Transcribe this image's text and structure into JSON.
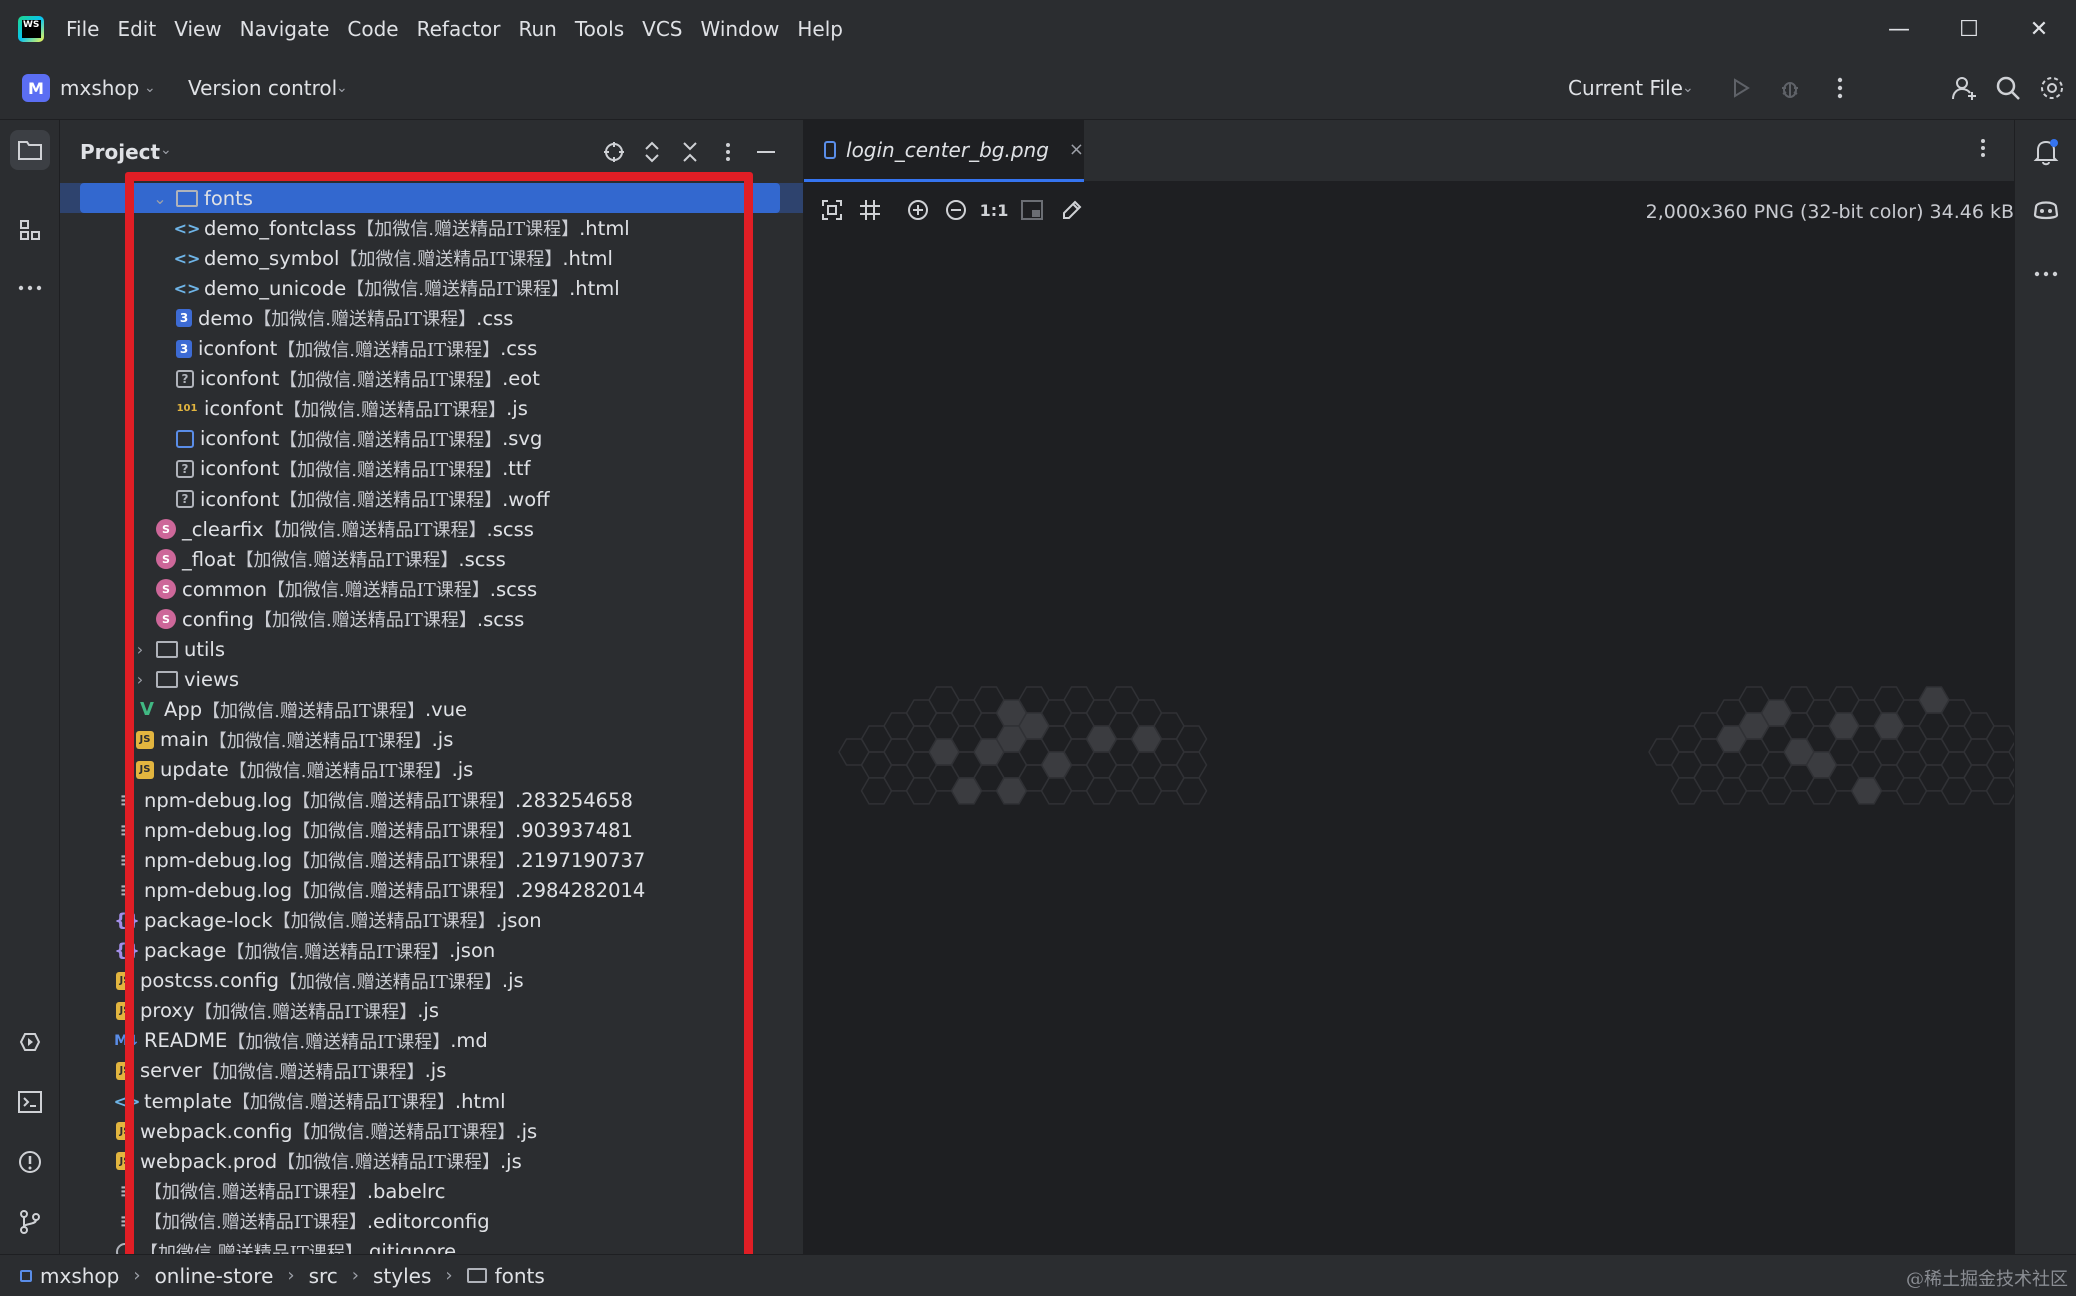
{
  "menu": [
    "File",
    "Edit",
    "View",
    "Navigate",
    "Code",
    "Refactor",
    "Run",
    "Tools",
    "VCS",
    "Window",
    "Help"
  ],
  "window_controls": {
    "minimize": "—",
    "maximize": "☐",
    "close": "✕"
  },
  "toolbar": {
    "project_badge": "M",
    "project_name": "mxshop",
    "version_control": "Version control",
    "run_config": "Current File"
  },
  "project_panel": {
    "title": "Project",
    "rows": [
      {
        "indent": 2,
        "icon": "folder",
        "expanded": true,
        "name": "fonts",
        "tag": "",
        "ext": "",
        "selected": true
      },
      {
        "indent": 3,
        "icon": "html",
        "name": "demo_fontclass",
        "tag": "【加微信.赠送精品IT课程】",
        "ext": ".html"
      },
      {
        "indent": 3,
        "icon": "html",
        "name": "demo_symbol",
        "tag": "【加微信.赠送精品IT课程】",
        "ext": ".html"
      },
      {
        "indent": 3,
        "icon": "html",
        "name": "demo_unicode",
        "tag": "【加微信.赠送精品IT课程】",
        "ext": ".html"
      },
      {
        "indent": 3,
        "icon": "css",
        "name": "demo",
        "tag": "【加微信.赠送精品IT课程】",
        "ext": ".css"
      },
      {
        "indent": 3,
        "icon": "css",
        "name": "iconfont",
        "tag": "【加微信.赠送精品IT课程】",
        "ext": ".css"
      },
      {
        "indent": 3,
        "icon": "unknown",
        "name": "iconfont",
        "tag": "【加微信.赠送精品IT课程】",
        "ext": ".eot"
      },
      {
        "indent": 3,
        "icon": "jsmap",
        "name": "iconfont",
        "tag": "【加微信.赠送精品IT课程】",
        "ext": ".js"
      },
      {
        "indent": 3,
        "icon": "svg",
        "name": "iconfont",
        "tag": "【加微信.赠送精品IT课程】",
        "ext": ".svg"
      },
      {
        "indent": 3,
        "icon": "unknown",
        "name": "iconfont",
        "tag": "【加微信.赠送精品IT课程】",
        "ext": ".ttf"
      },
      {
        "indent": 3,
        "icon": "unknown",
        "name": "iconfont",
        "tag": "【加微信.赠送精品IT课程】",
        "ext": ".woff"
      },
      {
        "indent": 2,
        "icon": "scss",
        "name": "_clearfix",
        "tag": "【加微信.赠送精品IT课程】",
        "ext": ".scss"
      },
      {
        "indent": 2,
        "icon": "scss",
        "name": "_float",
        "tag": "【加微信.赠送精品IT课程】",
        "ext": ".scss"
      },
      {
        "indent": 2,
        "icon": "scss",
        "name": "common",
        "tag": "【加微信.赠送精品IT课程】",
        "ext": ".scss"
      },
      {
        "indent": 2,
        "icon": "scss",
        "name": "confing",
        "tag": "【加微信.赠送精品IT课程】",
        "ext": ".scss"
      },
      {
        "indent": 1,
        "icon": "folder",
        "expanded": false,
        "name": "utils",
        "tag": "",
        "ext": ""
      },
      {
        "indent": 1,
        "icon": "folder",
        "expanded": false,
        "name": "views",
        "tag": "",
        "ext": ""
      },
      {
        "indent": 1,
        "icon": "vue",
        "name": "App",
        "tag": "【加微信.赠送精品IT课程】",
        "ext": ".vue"
      },
      {
        "indent": 1,
        "icon": "js",
        "name": "main",
        "tag": "【加微信.赠送精品IT课程】",
        "ext": ".js"
      },
      {
        "indent": 1,
        "icon": "js",
        "name": "update",
        "tag": "【加微信.赠送精品IT课程】",
        "ext": ".js"
      },
      {
        "indent": 0,
        "icon": "text",
        "name": "npm-debug.log",
        "tag": "【加微信.赠送精品IT课程】",
        "ext": ".283254658"
      },
      {
        "indent": 0,
        "icon": "text",
        "name": "npm-debug.log",
        "tag": "【加微信.赠送精品IT课程】",
        "ext": ".903937481"
      },
      {
        "indent": 0,
        "icon": "text",
        "name": "npm-debug.log",
        "tag": "【加微信.赠送精品IT课程】",
        "ext": ".2197190737"
      },
      {
        "indent": 0,
        "icon": "text",
        "name": "npm-debug.log",
        "tag": "【加微信.赠送精品IT课程】",
        "ext": ".2984282014"
      },
      {
        "indent": 0,
        "icon": "json",
        "name": "package-lock",
        "tag": "【加微信.赠送精品IT课程】",
        "ext": ".json"
      },
      {
        "indent": 0,
        "icon": "json",
        "name": "package",
        "tag": "【加微信.赠送精品IT课程】",
        "ext": ".json"
      },
      {
        "indent": 0,
        "icon": "js",
        "name": "postcss.config",
        "tag": "【加微信.赠送精品IT课程】",
        "ext": ".js"
      },
      {
        "indent": 0,
        "icon": "js",
        "name": "proxy",
        "tag": "【加微信.赠送精品IT课程】",
        "ext": ".js"
      },
      {
        "indent": 0,
        "icon": "md",
        "name": "README",
        "tag": "【加微信.赠送精品IT课程】",
        "ext": ".md"
      },
      {
        "indent": 0,
        "icon": "js",
        "name": "server",
        "tag": "【加微信.赠送精品IT课程】",
        "ext": ".js"
      },
      {
        "indent": 0,
        "icon": "html",
        "name": "template",
        "tag": "【加微信.赠送精品IT课程】",
        "ext": ".html"
      },
      {
        "indent": 0,
        "icon": "js",
        "name": "webpack.config",
        "tag": "【加微信.赠送精品IT课程】",
        "ext": ".js"
      },
      {
        "indent": 0,
        "icon": "js",
        "name": "webpack.prod",
        "tag": "【加微信.赠送精品IT课程】",
        "ext": ".js"
      },
      {
        "indent": 0,
        "icon": "text",
        "name": "",
        "tag": "【加微信.赠送精品IT课程】",
        "ext": ".babelrc"
      },
      {
        "indent": 0,
        "icon": "text",
        "name": "",
        "tag": "【加微信.赠送精品IT课程】",
        "ext": ".editorconfig"
      },
      {
        "indent": 0,
        "icon": "ignore",
        "name": "",
        "tag": "【加微信.赠送精品IT课程】",
        "ext": ".gitignore"
      }
    ]
  },
  "editor": {
    "tab_label": "login_center_bg.png",
    "tab_close": "×",
    "zoom_actual": "1:1",
    "image_info": "2,000x360 PNG (32-bit color) 34.46 kB"
  },
  "statusbar": {
    "crumbs": [
      "mxshop",
      "online-store",
      "src",
      "styles",
      "fonts"
    ],
    "watermark": "@稀土掘金技术社区"
  },
  "icons": {
    "html": "<>",
    "css": "3",
    "unknown": "?",
    "js": "JS",
    "jsmap": "101",
    "svg": "",
    "scss": "S",
    "folder": "",
    "vue": "V",
    "text": "≡",
    "json": "{}",
    "md": "M↓",
    "ignore": ""
  }
}
